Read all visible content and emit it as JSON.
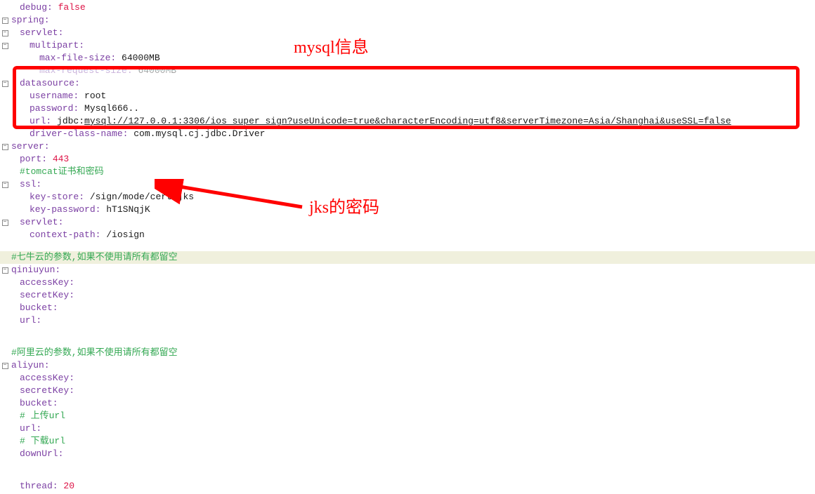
{
  "annotations": {
    "mysql": "mysql信息",
    "jks": "jks的密码"
  },
  "lines": {
    "debug_key": "debug:",
    "debug_val": "false",
    "spring": "spring:",
    "servlet": "servlet:",
    "multipart": "multipart:",
    "maxfilesize_key": "max-file-size:",
    "maxfilesize_val": "64000MB",
    "maxrequest_key": "max-request-size:",
    "maxrequest_val": "64000MB",
    "datasource": "datasource:",
    "username_key": "username:",
    "username_val": "root",
    "password_key": "password:",
    "password_val": "Mysql666..",
    "url_key": "url:",
    "url_val_prefix": "jdbc:",
    "url_val_link": "mysql://127.0.0.1:3306/ios_super_sign?useUnicode=true&characterEncoding=utf8&serverTimezone=Asia/Shanghai&useSSL=false",
    "driver_key": "driver-class-name:",
    "driver_val": "com.mysql.cj.jdbc.Driver",
    "server": "server:",
    "port_key": "port:",
    "port_val": "443",
    "tomcat_comment": "#tomcat证书和密码",
    "ssl": "ssl:",
    "keystore_key": "key-store:",
    "keystore_val": "/sign/mode/cert.jks",
    "keypassword_key": "key-password:",
    "keypassword_val": "hT1SNqjK",
    "servlet2": "servlet:",
    "contextpath_key": "context-path:",
    "contextpath_val": "/iosign",
    "qiniu_comment": "#七牛云的参数,如果不使用请所有都留空",
    "qiniuyun": "qiniuyun:",
    "accessKey": "accessKey:",
    "secretKey": "secretKey:",
    "bucket": "bucket:",
    "urlkey": "url:",
    "aliyun_comment": "#阿里云的参数,如果不使用请所有都留空",
    "aliyun": "aliyun:",
    "upload_comment": "#  上传url",
    "download_comment": "#  下载url",
    "downUrl": "downUrl:",
    "thread_key": "thread:",
    "thread_val": "20"
  }
}
